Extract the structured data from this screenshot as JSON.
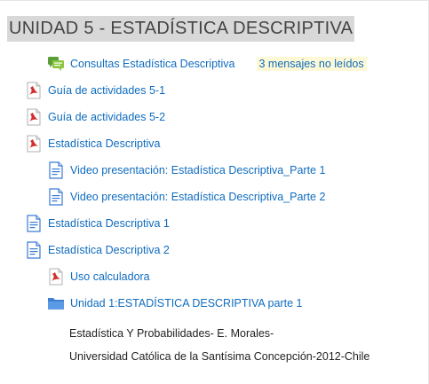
{
  "section": {
    "title": "UNIDAD 5 - ESTADÍSTICA DESCRIPTIVA"
  },
  "activities": [
    {
      "label": "Consultas Estadística Descriptiva",
      "icon": "forum-icon",
      "badge": "3 mensajes no leídos"
    },
    {
      "label": "Guía de actividades 5-1",
      "icon": "pdf-icon"
    },
    {
      "label": "Guía de actividades 5-2",
      "icon": "pdf-icon"
    },
    {
      "label": "Estadística Descriptiva",
      "icon": "pdf-icon"
    },
    {
      "label": "Video presentación: Estadística Descriptiva_Parte 1",
      "icon": "page-icon"
    },
    {
      "label": "Video presentación: Estadística Descriptiva_Parte 2",
      "icon": "page-icon"
    },
    {
      "label": "Estadística Descriptiva 1",
      "icon": "page-icon"
    },
    {
      "label": "Estadística Descriptiva 2",
      "icon": "page-icon"
    },
    {
      "label": "Uso calculadora",
      "icon": "pdf-icon"
    },
    {
      "label": "Unidad 1:ESTADÍSTICA DESCRIPTIVA parte 1",
      "icon": "folder-icon"
    }
  ],
  "label_lines": [
    "Estadística Y Probabilidades- E. Morales-",
    "Universidad Católica de la Santísima Concepción-2012-Chile"
  ],
  "colors": {
    "link": "#0f6cbf",
    "pdf_red": "#d32f2f",
    "forum_green": "#6ab04c",
    "page_blue": "#3a7bd5",
    "title_highlight": "#d8d8d8",
    "badge_bg": "#fdf9d6"
  }
}
